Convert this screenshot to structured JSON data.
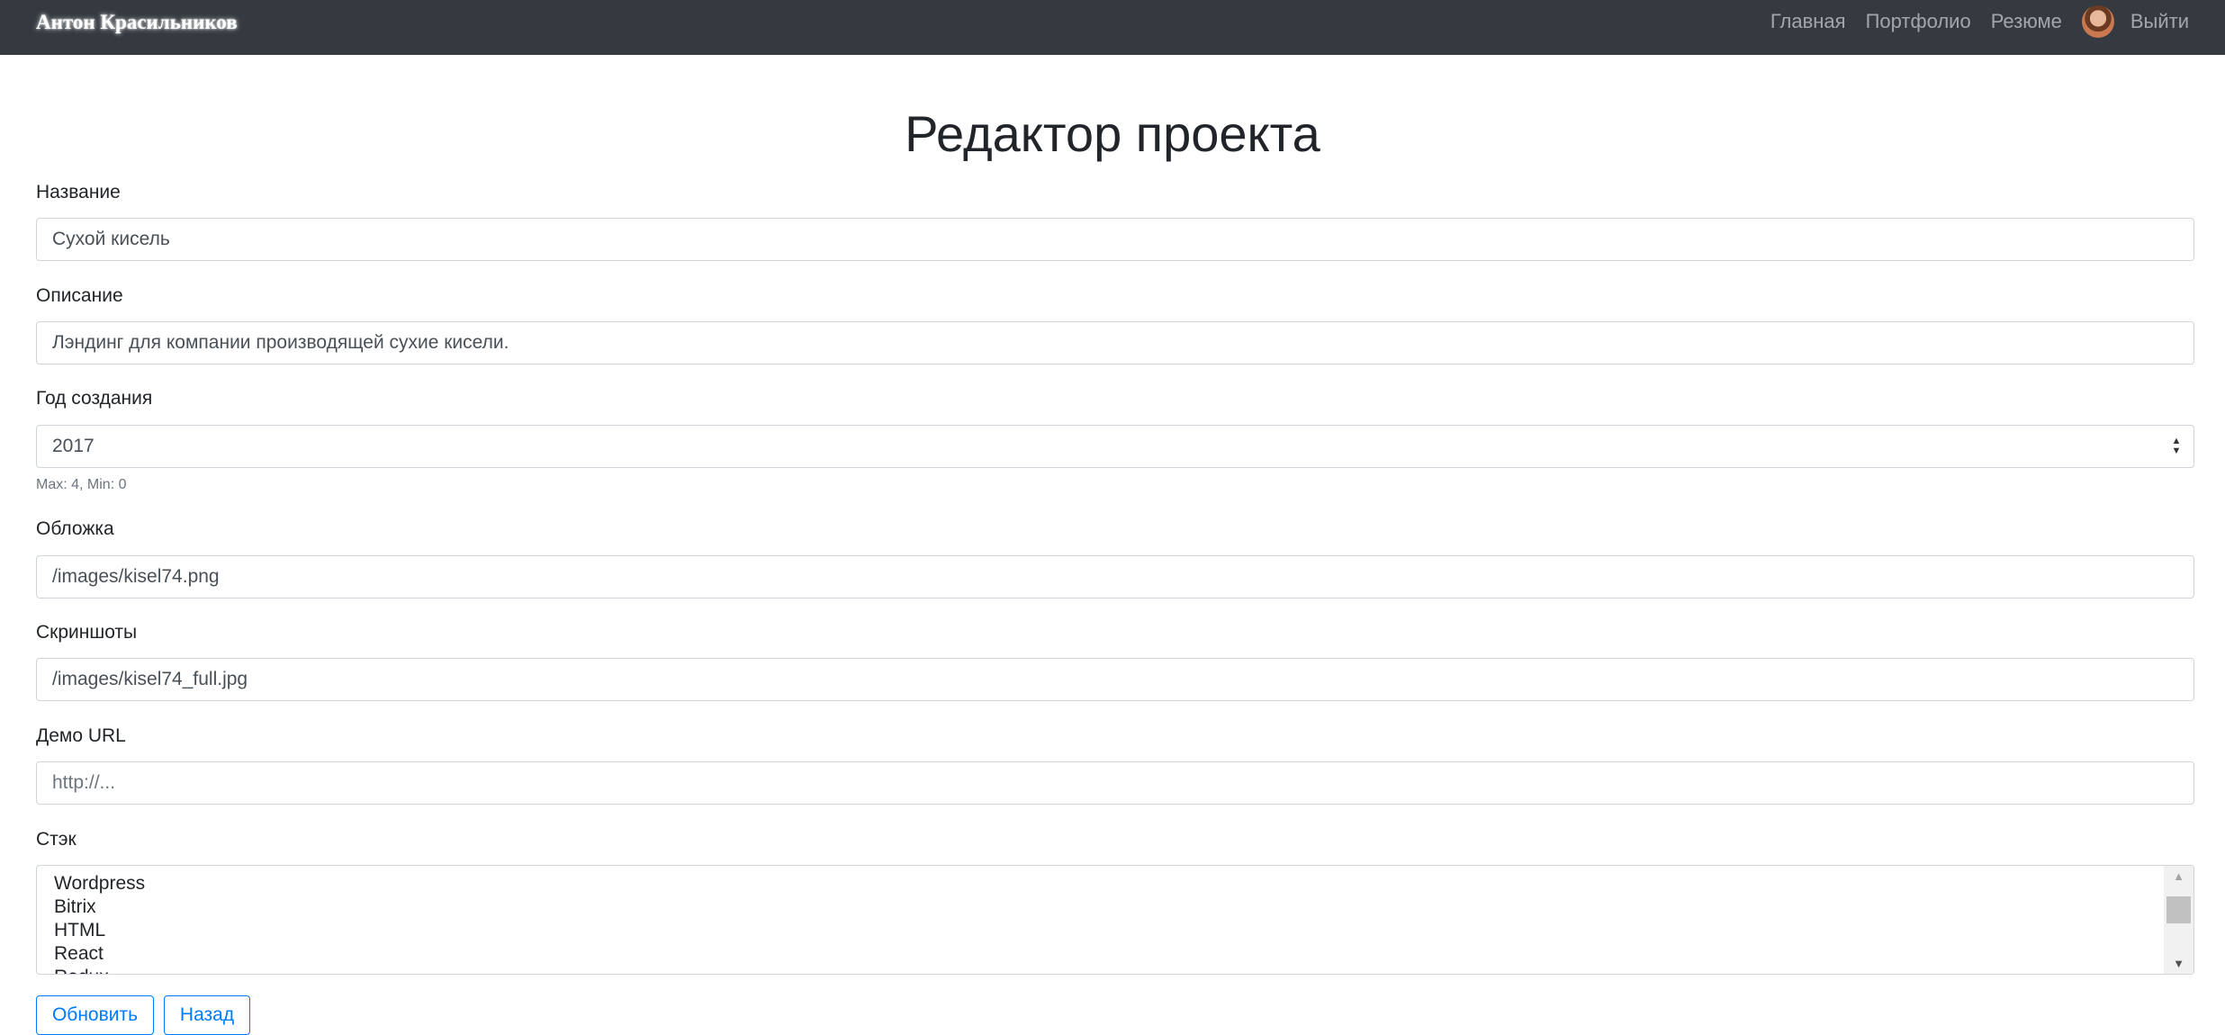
{
  "navbar": {
    "brand": "Антон Красильников",
    "links": [
      "Главная",
      "Портфолио",
      "Резюме"
    ],
    "logout": "Выйти"
  },
  "page": {
    "title": "Редактор проекта"
  },
  "form": {
    "name": {
      "label": "Название",
      "value": "Сухой кисель"
    },
    "description": {
      "label": "Описание",
      "value": "Лэндинг для компании производящей сухие кисели."
    },
    "year": {
      "label": "Год создания",
      "value": "2017",
      "hint": "Max: 4, Min: 0"
    },
    "cover": {
      "label": "Обложка",
      "value": "/images/kisel74.png"
    },
    "screenshots": {
      "label": "Скриншоты",
      "value": "/images/kisel74_full.jpg"
    },
    "demo": {
      "label": "Демо URL",
      "value": "",
      "placeholder": "http://..."
    },
    "stack": {
      "label": "Стэк",
      "options": [
        "Wordpress",
        "Bitrix",
        "HTML",
        "React",
        "Redux"
      ]
    },
    "buttons": {
      "update": "Обновить",
      "back": "Назад"
    }
  },
  "colors": {
    "navbar_bg": "#343a40",
    "accent": "#007bff"
  }
}
